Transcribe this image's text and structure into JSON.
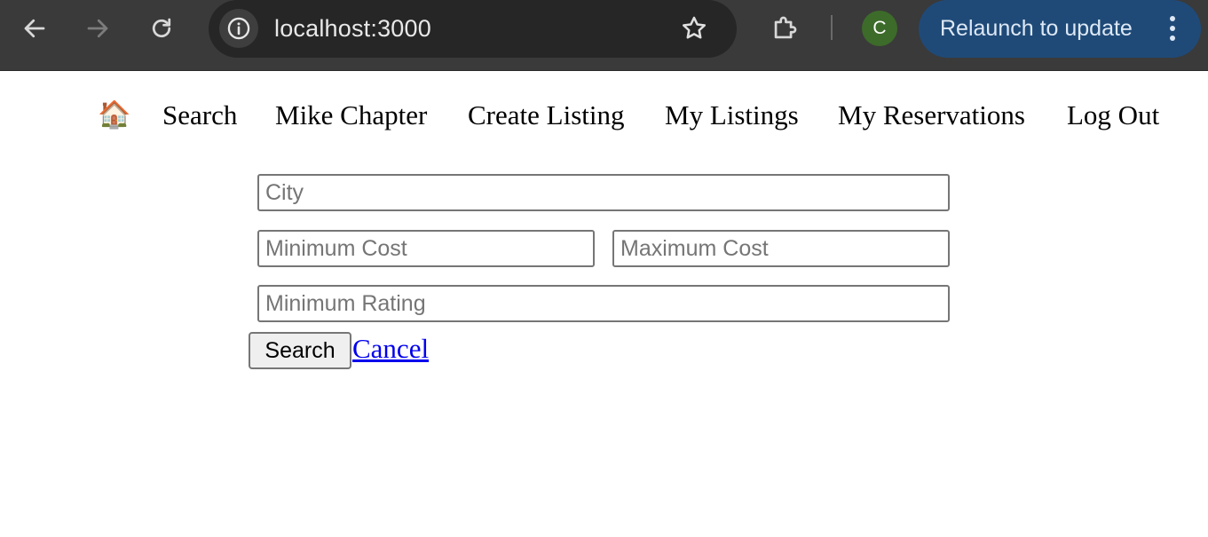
{
  "browser": {
    "url": "localhost:3000",
    "profile_initial": "C",
    "relaunch_label": "Relaunch to update",
    "colors": {
      "chrome_bg": "#3a3a3a",
      "omnibox_bg": "#262626",
      "relaunch_bg": "#1f4a78",
      "avatar_bg": "#3d6b2a"
    }
  },
  "nav": {
    "home_icon": "🏠",
    "items": [
      {
        "label": "Search"
      },
      {
        "label": "Mike Chapter"
      },
      {
        "label": "Create Listing"
      },
      {
        "label": "My Listings"
      },
      {
        "label": "My Reservations"
      },
      {
        "label": "Log Out"
      }
    ]
  },
  "search_form": {
    "city": {
      "placeholder": "City",
      "value": ""
    },
    "min_cost": {
      "placeholder": "Minimum Cost",
      "value": ""
    },
    "max_cost": {
      "placeholder": "Maximum Cost",
      "value": ""
    },
    "min_rating": {
      "placeholder": "Minimum Rating",
      "value": ""
    },
    "submit_label": "Search",
    "cancel_label": "Cancel"
  }
}
